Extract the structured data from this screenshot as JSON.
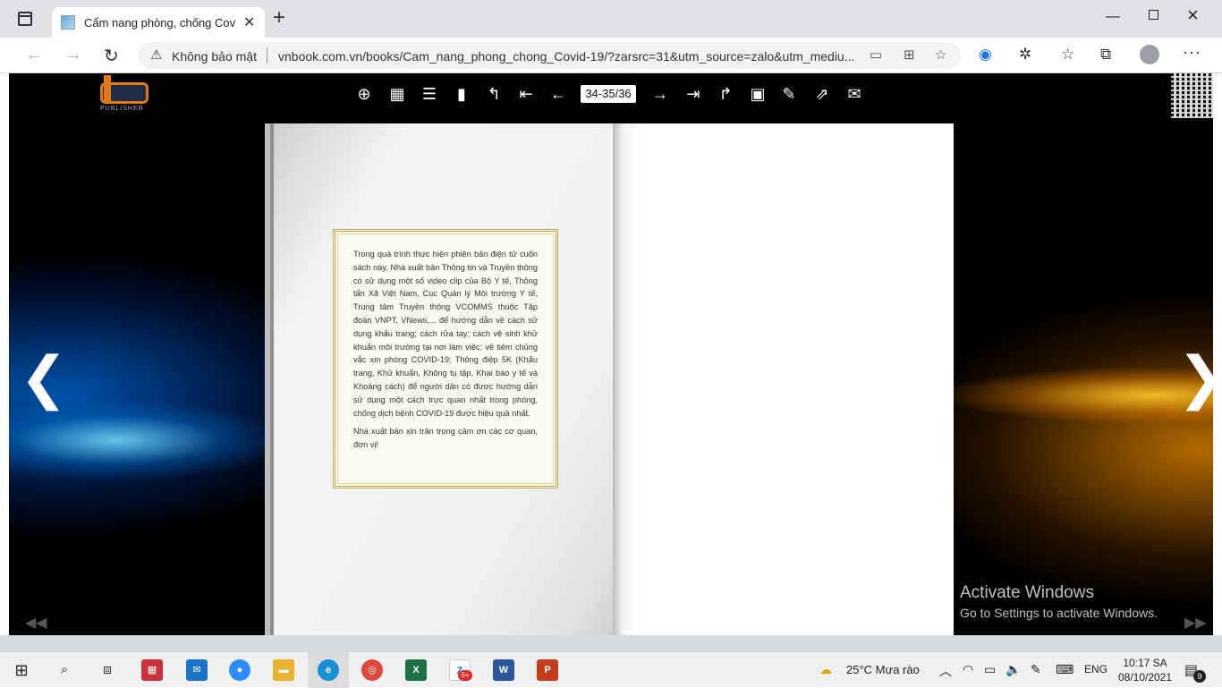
{
  "browser": {
    "tab_title": "Cẩm nang phòng, chống Covid-",
    "tab_close": "✕",
    "new_tab": "+",
    "security_label": "Không bảo mật",
    "url": "vnbook.com.vn/books/Cam_nang_phong_chong_Covid-19/?zarsrc=31&utm_source=zalo&utm_mediu..."
  },
  "viewer": {
    "page_indicator": "34-35/36",
    "logo_text": "PUBLISHER",
    "frame_paragraphs": [
      "Trong quá trình thực hiện phiên bản điện tử cuốn sách này, Nhà xuất bản Thông tin và Truyền thông có sử dụng một số video clip của Bộ Y tế, Thông tấn Xã Việt Nam, Cục Quản lý Môi trường Y tế, Trung tâm Truyền thông VCOMMS thuộc Tập đoàn VNPT, VNews,... để hướng dẫn về cách sử dụng khẩu trang; cách rửa tay; cách vệ sinh khử khuẩn môi trường tại nơi làm việc; về tiêm chủng vắc xin phòng COVID-19; Thông điệp 5K (Khẩu trang, Khử khuẩn, Không tụ tập, Khai báo y tế và Khoảng cách) để người dân có được hướng dẫn sử dụng một cách trực quan nhất trong phòng, chống dịch bệnh COVID-19 được hiệu quả nhất.",
      "Nhà xuất bản xin trân trọng cảm ơn các cơ quan, đơn vị!"
    ],
    "arrow_prev": "❮",
    "arrow_next": "❯",
    "corner_prev": "◀◀",
    "corner_next": "▶▶"
  },
  "watermark": {
    "title": "Activate Windows",
    "subtitle": "Go to Settings to activate Windows."
  },
  "taskbar": {
    "weather": "25°C  Mưa rào",
    "lang": "ENG",
    "time": "10:17 SA",
    "date": "08/10/2021",
    "notifications": "9",
    "zalo_badge": "5+"
  }
}
